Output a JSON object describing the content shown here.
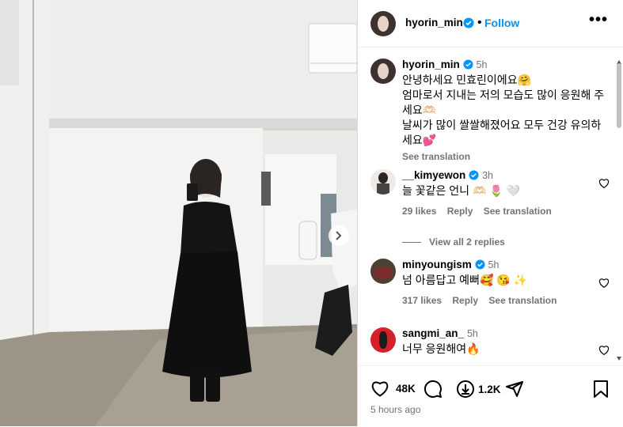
{
  "post": {
    "username": "hyorin_min",
    "follow_label": "Follow",
    "more_label": "•••"
  },
  "caption": {
    "username": "hyorin_min",
    "time": "5h",
    "lines": [
      "안녕하세요 민효린이에요🤗",
      "엄마로서 지내는 저의 모습도 많이 응원해 주세요🫶🏻",
      "날씨가 많이 쌀쌀해졌어요 모두 건강 유의하세요💕"
    ],
    "see_translation": "See translation"
  },
  "comments": [
    {
      "username": "__kimyewon",
      "time": "3h",
      "text": "늘 꽃같은 언니 🫶🏻 🌷 🤍",
      "likes": "29 likes",
      "reply": "Reply",
      "see_translation": "See translation",
      "view_replies": "View all 2 replies"
    },
    {
      "username": "minyoungism",
      "time": "5h",
      "text": "넘 아름답고 예뻐🥰 😘 ✨",
      "likes": "317 likes",
      "reply": "Reply",
      "see_translation": "See translation"
    },
    {
      "username": "sangmi_an_",
      "time": "5h",
      "text": "너무 응원해여🔥"
    }
  ],
  "actions": {
    "likes_count": "48K",
    "saves_count": "1.2K",
    "timestamp": "5 hours ago"
  },
  "colors": {
    "accent": "#0095f6",
    "verified": "#0095f6",
    "muted": "#737373"
  },
  "icons": [
    "verified-icon",
    "heart-icon",
    "comment-icon",
    "download-icon",
    "share-icon",
    "bookmark-icon",
    "chevron-right-icon",
    "more-icon"
  ]
}
